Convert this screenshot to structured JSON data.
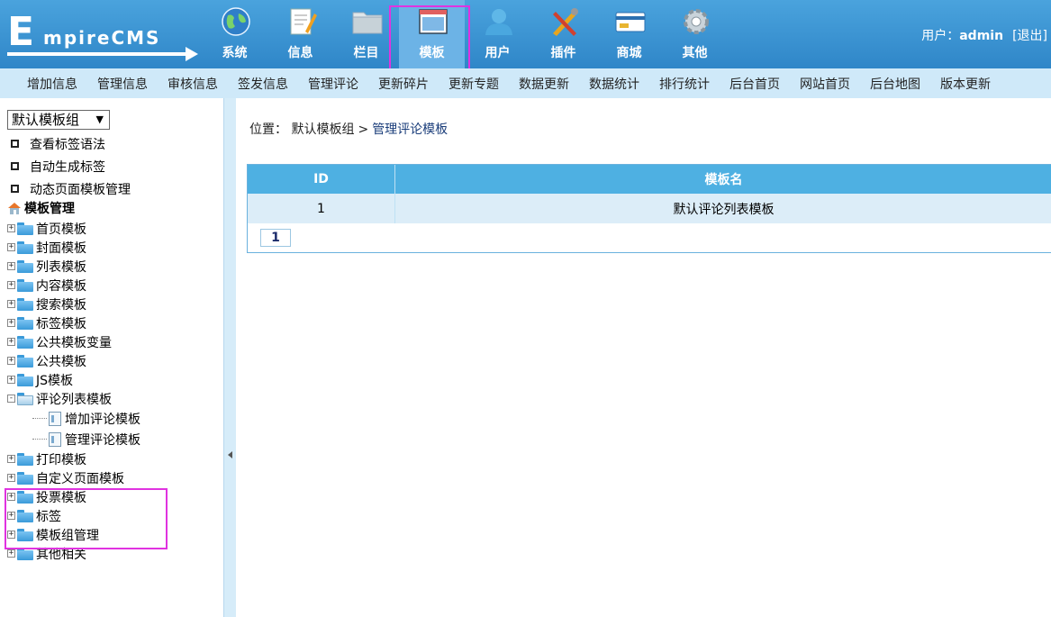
{
  "logo": {
    "big_letter": "E",
    "text": "mpireCMS"
  },
  "nav": [
    {
      "label": "系统",
      "icon": "globe-icon",
      "active": false
    },
    {
      "label": "信息",
      "icon": "document-pencil-icon",
      "active": false
    },
    {
      "label": "栏目",
      "icon": "folder-icon",
      "active": false
    },
    {
      "label": "模板",
      "icon": "window-template-icon",
      "active": true
    },
    {
      "label": "用户",
      "icon": "user-icon",
      "active": false
    },
    {
      "label": "插件",
      "icon": "tools-icon",
      "active": false
    },
    {
      "label": "商城",
      "icon": "card-icon",
      "active": false
    },
    {
      "label": "其他",
      "icon": "gear-icon",
      "active": false
    }
  ],
  "user": {
    "prefix": "用户：",
    "name": "admin",
    "logout": "[退出]"
  },
  "submenu": [
    "增加信息",
    "管理信息",
    "审核信息",
    "签发信息",
    "管理评论",
    "更新碎片",
    "更新专题",
    "数据更新",
    "数据统计",
    "排行统计",
    "后台首页",
    "网站首页",
    "后台地图",
    "版本更新"
  ],
  "sidebar": {
    "group_select": "默认模板组",
    "links": [
      "查看标签语法",
      "自动生成标签",
      "动态页面模板管理"
    ],
    "tree_title": "模板管理",
    "tree": [
      "首页模板",
      "封面模板",
      "列表模板",
      "内容模板",
      "搜索模板",
      "标签模板",
      "公共模板变量",
      "公共模板",
      "JS模板"
    ],
    "expanded": {
      "label": "评论列表模板",
      "children": [
        "增加评论模板",
        "管理评论模板"
      ]
    },
    "tree_after": [
      "打印模板",
      "自定义页面模板",
      "投票模板",
      "标签",
      "模板组管理",
      "其他相关"
    ]
  },
  "main": {
    "crumb_label": "位置：",
    "crumb_1": "默认模板组",
    "crumb_sep": ">",
    "crumb_2": "管理评论模板",
    "table": {
      "headers": [
        "ID",
        "模板名"
      ],
      "rows": [
        {
          "id": "1",
          "name": "默认评论列表模板"
        }
      ]
    },
    "pagination": "1"
  },
  "colors": {
    "header": "#2f86c8",
    "submenu": "#cfe9f9",
    "table_head": "#4eb0e2",
    "highlight": "#e033e0"
  }
}
